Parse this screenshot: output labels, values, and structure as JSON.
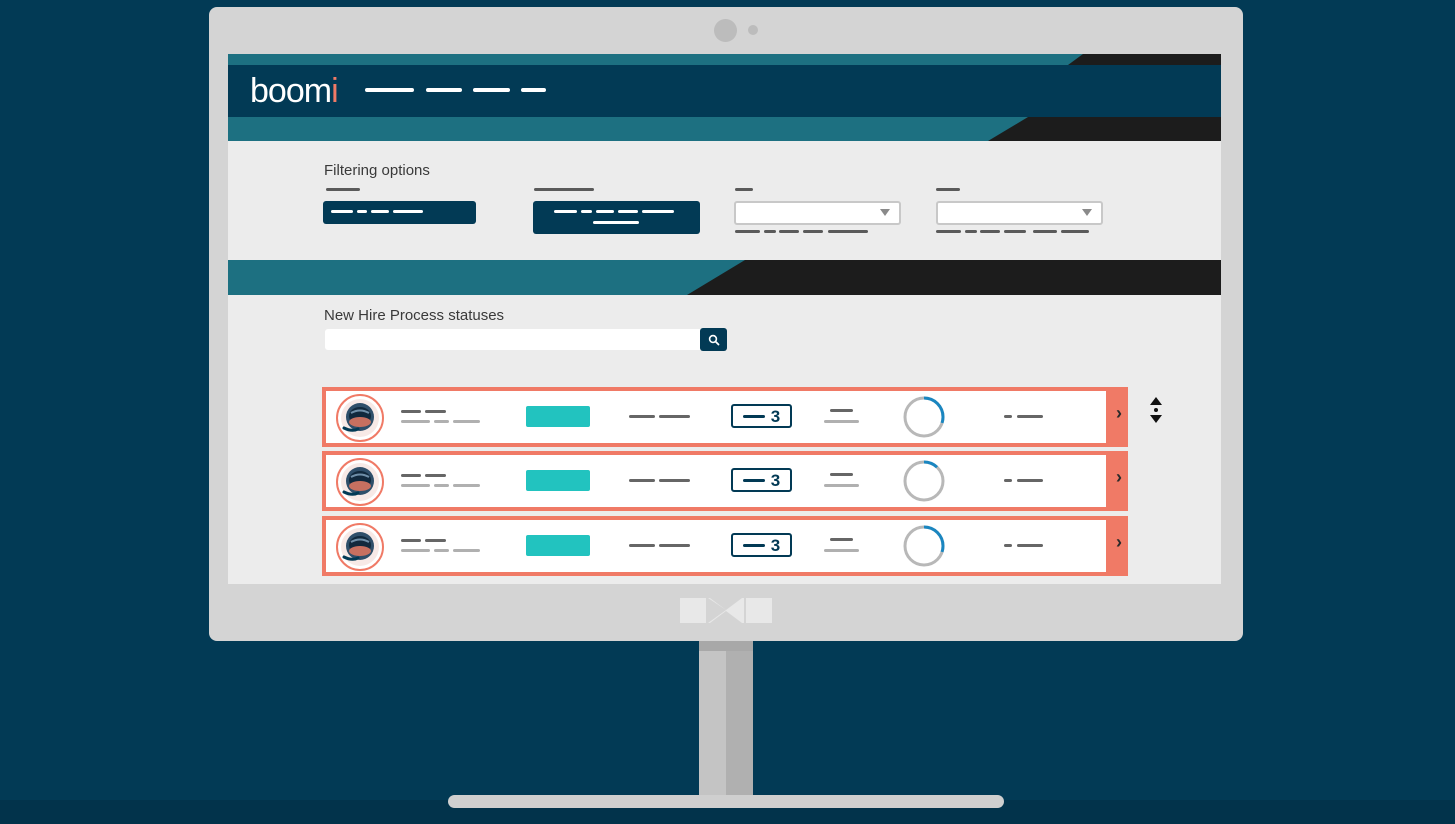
{
  "header": {
    "brand_text": "boom",
    "brand_dot_letter": "i"
  },
  "filters": {
    "title": "Filtering options"
  },
  "statuses": {
    "title": "New Hire Process statuses",
    "search_placeholder": ""
  },
  "rows": [
    {
      "count": "3",
      "progress": 0.3
    },
    {
      "count": "3",
      "progress": 0.12
    },
    {
      "count": "3",
      "progress": 0.3
    }
  ],
  "colors": {
    "navy": "#023a55",
    "teal": "#1d7081",
    "accent_coral": "#f07a66",
    "status_teal": "#22c3bf",
    "progress_blue": "#1a86c0"
  },
  "icons": {
    "search": "search-icon",
    "chevron": "chevron-right-icon",
    "sort": "sort-icon",
    "avatar": "astronaut-avatar-icon"
  }
}
